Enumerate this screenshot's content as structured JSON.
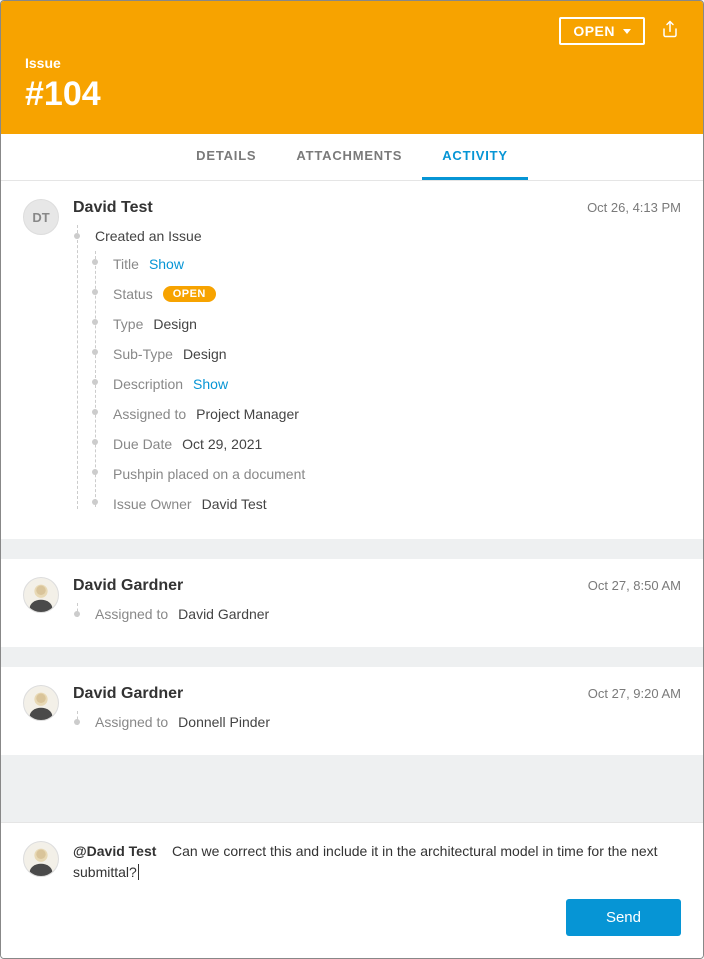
{
  "header": {
    "status_button": "OPEN",
    "label": "Issue",
    "issue_number": "#104"
  },
  "tabs": {
    "details": "DETAILS",
    "attachments": "ATTACHMENTS",
    "activity": "ACTIVITY"
  },
  "activity": [
    {
      "avatar_initials": "DT",
      "avatar_type": "initials",
      "author": "David Test",
      "timestamp": "Oct 26, 4:13 PM",
      "main_line": "Created an Issue",
      "details": [
        {
          "label": "Title",
          "value": "Show",
          "value_kind": "link"
        },
        {
          "label": "Status",
          "value": "OPEN",
          "value_kind": "badge"
        },
        {
          "label": "Type",
          "value": "Design",
          "value_kind": "text"
        },
        {
          "label": "Sub-Type",
          "value": "Design",
          "value_kind": "text"
        },
        {
          "label": "Description",
          "value": "Show",
          "value_kind": "link"
        },
        {
          "label": "Assigned to",
          "value": "Project Manager",
          "value_kind": "text"
        },
        {
          "label": "Due Date",
          "value": "Oct 29, 2021",
          "value_kind": "text"
        },
        {
          "label": "",
          "value": "Pushpin placed on a document",
          "value_kind": "plain"
        },
        {
          "label": "Issue Owner",
          "value": "David Test",
          "value_kind": "text"
        }
      ]
    },
    {
      "avatar_type": "photo",
      "author": "David Gardner",
      "timestamp": "Oct 27, 8:50 AM",
      "main_line": null,
      "details": [
        {
          "label": "Assigned to",
          "value": "David Gardner",
          "value_kind": "text"
        }
      ]
    },
    {
      "avatar_type": "photo",
      "author": "David Gardner",
      "timestamp": "Oct 27, 9:20 AM",
      "main_line": null,
      "details": [
        {
          "label": "Assigned to",
          "value": "Donnell Pinder",
          "value_kind": "text"
        }
      ]
    }
  ],
  "composer": {
    "mention": "@David Test",
    "text": "Can we correct this and include it in the architectural model in time for the next submittal?",
    "send_label": "Send"
  }
}
